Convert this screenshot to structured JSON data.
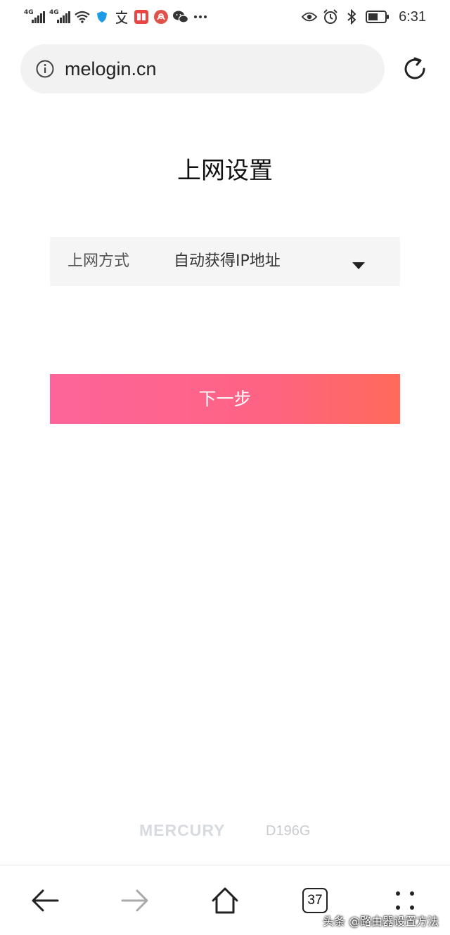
{
  "status_bar": {
    "network_1": "4G",
    "network_2": "4G",
    "time": "6:31",
    "icons": [
      "signal-icon",
      "wifi-icon",
      "shield-icon",
      "zhi-icon",
      "book-icon",
      "radio-icon",
      "wechat-icon",
      "more-dots-icon",
      "eye-icon",
      "alarm-icon",
      "bluetooth-icon",
      "battery-icon"
    ]
  },
  "browser": {
    "url": "melogin.cn"
  },
  "page": {
    "title": "上网设置",
    "connection_label": "上网方式",
    "connection_value": "自动获得IP地址",
    "next_label": "下一步"
  },
  "footer": {
    "brand": "MERCURY",
    "model": "D196G"
  },
  "nav": {
    "tabs_count": "37",
    "icons": [
      "back-icon",
      "forward-icon",
      "home-icon",
      "tabs-icon",
      "menu-icon"
    ]
  },
  "watermark": "头条 @路由器设置方法",
  "colors": {
    "button_gradient_start": "#fd659a",
    "button_gradient_end": "#ff6a5a",
    "address_bar_bg": "#f2f2f2"
  }
}
